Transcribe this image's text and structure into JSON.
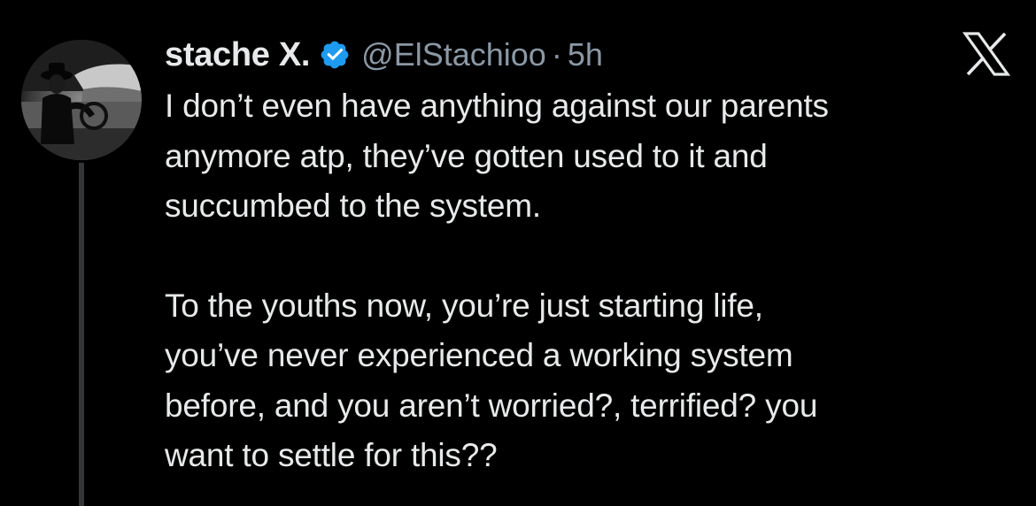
{
  "tweet": {
    "display_name": "stache X.",
    "handle": "@ElStachioo",
    "separator": "·",
    "time": "5h",
    "paragraphs": [
      [
        "I don’t even have anything against our parents",
        "anymore atp, they’ve gotten used to it and",
        "succumbed to the system."
      ],
      [
        "To the youths now, you’re just starting life,",
        "you’ve never experienced a working system",
        "before, and you aren’t worried?, terrified? you",
        "want to settle for this??"
      ]
    ]
  },
  "icons": {
    "verified": "verified-badge-icon",
    "logo": "x-logo-icon"
  },
  "colors": {
    "background": "#000000",
    "text": "#e7e9ea",
    "secondary_text": "#8b98a5",
    "verified_blue": "#1d9bf0",
    "thread_line": "#333639"
  }
}
